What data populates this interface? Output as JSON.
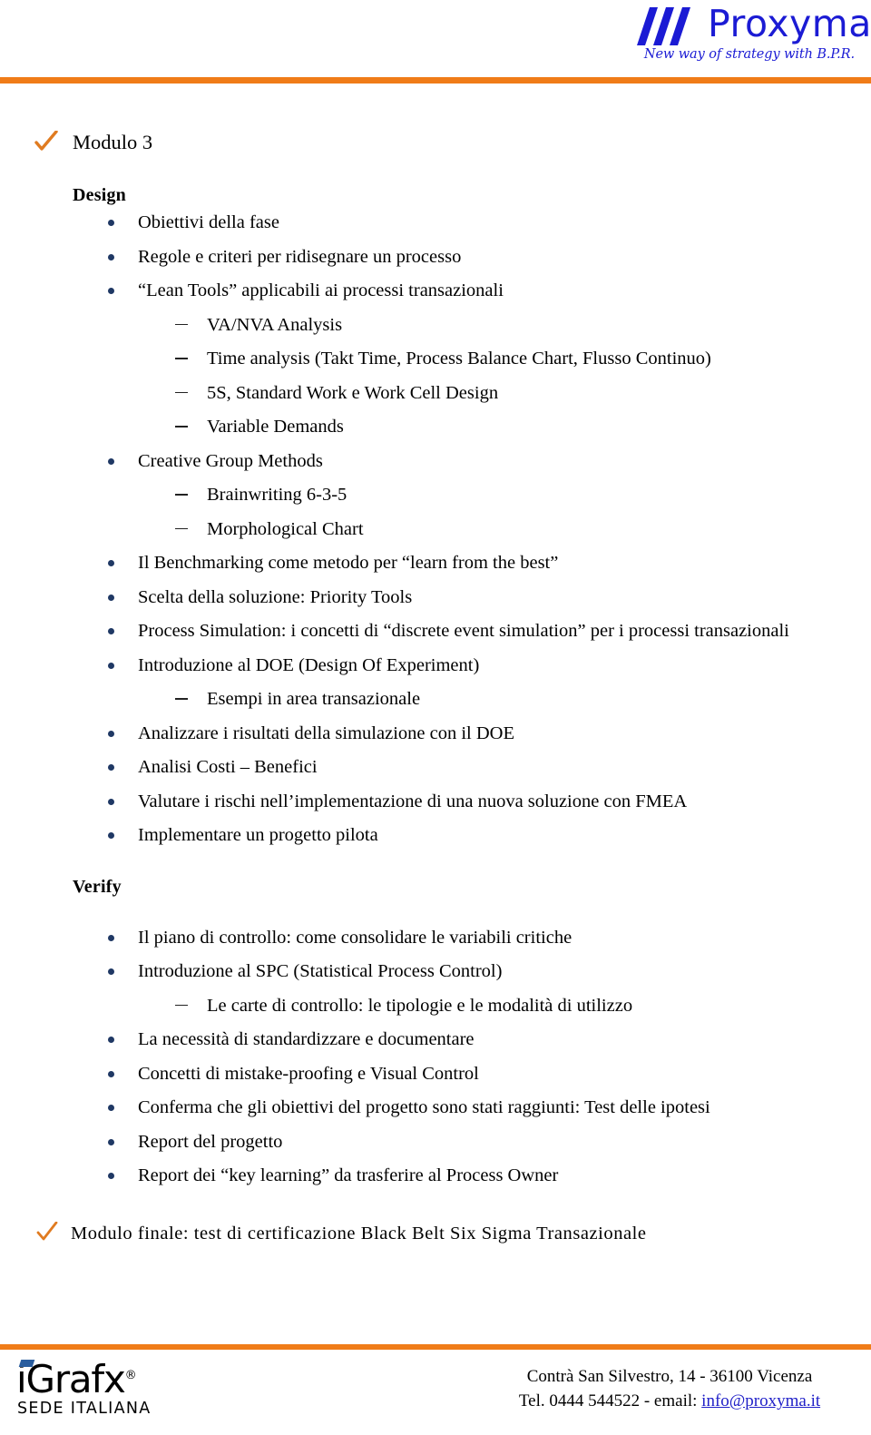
{
  "header": {
    "brand_name": "Proxyma",
    "brand_registered": "®",
    "tagline": "New way of strategy with B.P.R.",
    "logo_icon": "three-slashes-icon",
    "accent_color": "#f07c18",
    "brand_color": "#1b1bd4"
  },
  "module": {
    "check_icon": "orange-checkmark-icon",
    "title": "Modulo 3"
  },
  "sections": [
    {
      "heading": "Design",
      "items": [
        {
          "level": 1,
          "text": "Obiettivi della fase"
        },
        {
          "level": 1,
          "text": "Regole e criteri per ridisegnare un processo"
        },
        {
          "level": 1,
          "text": "“Lean Tools” applicabili ai processi transazionali"
        },
        {
          "level": 2,
          "text": "VA/NVA Analysis"
        },
        {
          "level": 2,
          "text": "Time analysis (Takt Time, Process Balance Chart, Flusso Continuo)"
        },
        {
          "level": 2,
          "text": "5S, Standard Work e Work Cell Design"
        },
        {
          "level": 2,
          "text": "Variable Demands"
        },
        {
          "level": 1,
          "text": "Creative Group Methods"
        },
        {
          "level": 2,
          "text": "Brainwriting 6-3-5"
        },
        {
          "level": 2,
          "text": "Morphological Chart"
        },
        {
          "level": 1,
          "text": "Il Benchmarking come metodo per “learn from the best”"
        },
        {
          "level": 1,
          "text": "Scelta della soluzione: Priority Tools"
        },
        {
          "level": 1,
          "justify": true,
          "text": "Process Simulation: i concetti di “discrete event simulation” per i processi transazionali"
        },
        {
          "level": 1,
          "text": "Introduzione al DOE (Design Of Experiment)"
        },
        {
          "level": 2,
          "text": "Esempi in area transazionale"
        },
        {
          "level": 1,
          "text": "Analizzare i risultati della simulazione con il DOE"
        },
        {
          "level": 1,
          "text": "Analisi Costi – Benefici"
        },
        {
          "level": 1,
          "text": "Valutare i rischi nell’implementazione di una nuova soluzione con FMEA"
        },
        {
          "level": 1,
          "text": "Implementare un progetto pilota"
        }
      ]
    },
    {
      "heading": "Verify",
      "items": [
        {
          "level": 1,
          "text": "Il piano di controllo: come consolidare le variabili critiche"
        },
        {
          "level": 1,
          "text": "Introduzione al SPC (Statistical Process Control)"
        },
        {
          "level": 2,
          "text": "Le carte di controllo: le tipologie e le modalità di utilizzo"
        },
        {
          "level": 1,
          "text": "La necessità di standardizzare e documentare"
        },
        {
          "level": 1,
          "text": "Concetti di mistake-proofing e Visual Control"
        },
        {
          "level": 1,
          "text": "Conferma che gli obiettivi del progetto sono stati raggiunti: Test delle ipotesi"
        },
        {
          "level": 1,
          "text": "Report del progetto"
        },
        {
          "level": 1,
          "text": "Report dei “key learning” da trasferire al Process Owner"
        }
      ]
    }
  ],
  "final_note": {
    "check_icon": "orange-checkmark-icon",
    "text": "Modulo finale: test di certificazione Black Belt Six Sigma Transazionale"
  },
  "footer": {
    "partner_logo_name": "iGrafx",
    "partner_logo_registered": "®",
    "partner_logo_subtitle": "SEDE  ITALIANA",
    "address_line": "Contrà San Silvestro, 14 - 36100 Vicenza",
    "contact_prefix": "Tel. 0444 544522 - email: ",
    "email": "info@proxyma.it",
    "email_color": "#2020c8",
    "accent_color": "#f07c18"
  }
}
